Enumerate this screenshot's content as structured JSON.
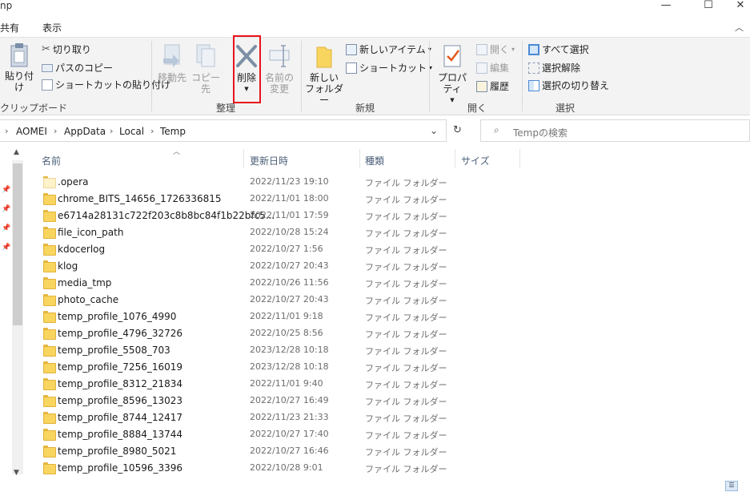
{
  "window": {
    "title": "np",
    "min_glyph": "—",
    "max_glyph": "☐",
    "close_glyph": "✕"
  },
  "ribbon_tabs": [
    "共有",
    "表示"
  ],
  "ribbon": {
    "clipboard": {
      "paste": "貼り付け",
      "cut": "切り取り",
      "copy_path": "パスのコピー",
      "paste_shortcut": "ショートカットの貼り付け",
      "group": "クリップボード"
    },
    "organize": {
      "move_to": "移動先",
      "copy_to": "コピー先",
      "delete_line1": "削除",
      "rename_line1": "名前の",
      "rename_line2": "変更",
      "group": "整理"
    },
    "new": {
      "new_folder_line1": "新しい",
      "new_folder_line2": "フォルダー",
      "new_item": "新しいアイテム",
      "shortcut": "ショートカット",
      "group": "新規"
    },
    "open": {
      "properties": "プロパティ",
      "open": "開く",
      "edit": "編集",
      "history": "履歴",
      "group": "開く"
    },
    "select": {
      "select_all": "すべて選択",
      "select_none": "選択解除",
      "invert": "選択の切り替え",
      "group": "選択"
    }
  },
  "address": {
    "crumbs": [
      "AOMEI",
      "AppData",
      "Local",
      "Temp"
    ],
    "search_placeholder": "Tempの検索"
  },
  "columns": {
    "name": "名前",
    "date": "更新日時",
    "type": "種類",
    "size": "サイズ"
  },
  "files": [
    {
      "name": ".opera",
      "date": "2022/11/23 19:10",
      "type": "ファイル フォルダー"
    },
    {
      "name": "chrome_BITS_14656_1726336815",
      "date": "2022/11/01 18:00",
      "type": "ファイル フォルダー"
    },
    {
      "name": "e6714a28131c722f203c8b8bc84f1b22bfc5...",
      "date": "2022/11/01 17:59",
      "type": "ファイル フォルダー"
    },
    {
      "name": "file_icon_path",
      "date": "2022/10/28 15:24",
      "type": "ファイル フォルダー"
    },
    {
      "name": "kdocerlog",
      "date": "2022/10/27 1:56",
      "type": "ファイル フォルダー"
    },
    {
      "name": "klog",
      "date": "2022/10/27 20:43",
      "type": "ファイル フォルダー"
    },
    {
      "name": "media_tmp",
      "date": "2022/10/26 11:56",
      "type": "ファイル フォルダー"
    },
    {
      "name": "photo_cache",
      "date": "2022/10/27 20:43",
      "type": "ファイル フォルダー"
    },
    {
      "name": "temp_profile_1076_4990",
      "date": "2022/11/01 9:18",
      "type": "ファイル フォルダー"
    },
    {
      "name": "temp_profile_4796_32726",
      "date": "2022/10/25 8:56",
      "type": "ファイル フォルダー"
    },
    {
      "name": "temp_profile_5508_703",
      "date": "2023/12/28 10:18",
      "type": "ファイル フォルダー"
    },
    {
      "name": "temp_profile_7256_16019",
      "date": "2023/12/28 10:18",
      "type": "ファイル フォルダー"
    },
    {
      "name": "temp_profile_8312_21834",
      "date": "2022/11/01 9:40",
      "type": "ファイル フォルダー"
    },
    {
      "name": "temp_profile_8596_13023",
      "date": "2022/10/27 16:49",
      "type": "ファイル フォルダー"
    },
    {
      "name": "temp_profile_8744_12417",
      "date": "2022/11/23 21:33",
      "type": "ファイル フォルダー"
    },
    {
      "name": "temp_profile_8884_13744",
      "date": "2022/10/27 17:40",
      "type": "ファイル フォルダー"
    },
    {
      "name": "temp_profile_8980_5021",
      "date": "2022/10/27 16:46",
      "type": "ファイル フォルダー"
    },
    {
      "name": "temp_profile_10596_3396",
      "date": "2022/10/28 9:01",
      "type": "ファイル フォルダー"
    }
  ],
  "colors": {
    "highlight_box": "#e8141b",
    "folder": "#f8d55f",
    "ribbon_bg": "#f3f3f3"
  }
}
